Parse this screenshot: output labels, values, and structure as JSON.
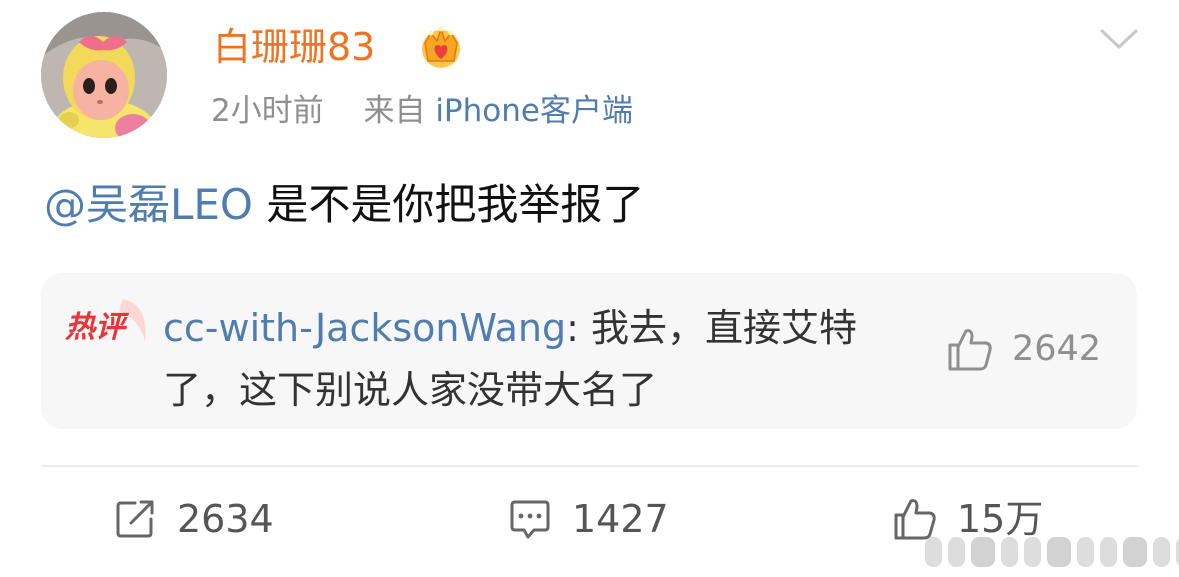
{
  "post": {
    "username": "白珊珊83",
    "vip_icon": "crown-badge-icon",
    "time": "2小时前",
    "source_prefix": "来自",
    "source": "iPhone客户端",
    "mention": "@吴磊LEO",
    "text": "是不是你把我举报了"
  },
  "hot_comment": {
    "badge": "热评",
    "author": "cc-with-JacksonWang",
    "separator": ": ",
    "text": "我去，直接艾特了，这下别说人家没带大名了",
    "likes": "2642"
  },
  "actions": {
    "repost_count": "2634",
    "comment_count": "1427",
    "like_count": "15万"
  },
  "colors": {
    "username": "#f2731f",
    "link": "#507daf",
    "meta": "#8f8f8f",
    "hot_badge": "#e8343b"
  },
  "icons": [
    "chevron-down-icon",
    "repost-icon",
    "comment-icon",
    "thumbs-up-icon"
  ]
}
